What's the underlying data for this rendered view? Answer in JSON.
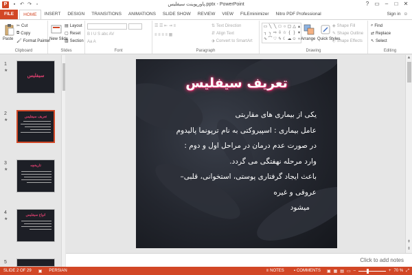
{
  "window": {
    "title": "پاورپوینت سیفلیس.pptx - PowerPoint",
    "controls": [
      "?",
      "▭",
      "–",
      "□",
      "✕"
    ]
  },
  "tabs": [
    {
      "label": "FILE"
    },
    {
      "label": "HOME"
    },
    {
      "label": "INSERT"
    },
    {
      "label": "DESIGN"
    },
    {
      "label": "TRANSITIONS"
    },
    {
      "label": "ANIMATIONS"
    },
    {
      "label": "SLIDE SHOW"
    },
    {
      "label": "REVIEW"
    },
    {
      "label": "VIEW"
    },
    {
      "label": "FILEminimizer"
    },
    {
      "label": "Nitro PDF Professional"
    }
  ],
  "active_tab": "HOME",
  "signin": "Sign in",
  "ribbon": {
    "clipboard": {
      "label": "Clipboard",
      "paste": "Paste",
      "cut": "Cut",
      "copy": "Copy",
      "format_painter": "Format Painter"
    },
    "slides": {
      "label": "Slides",
      "new_slide": "New Slide",
      "layout": "Layout",
      "reset": "Reset",
      "section": "Section"
    },
    "font": {
      "label": "Font"
    },
    "paragraph": {
      "label": "Paragraph",
      "text_direction": "Text Direction",
      "align_text": "Align Text",
      "convert_smartart": "Convert to SmartArt"
    },
    "drawing": {
      "label": "Drawing",
      "arrange": "Arrange",
      "quick_styles": "Quick Styles",
      "shape_fill": "Shape Fill",
      "shape_outline": "Shape Outline",
      "shape_effects": "Shape Effects"
    },
    "editing": {
      "label": "Editing",
      "find": "Find",
      "replace": "Replace",
      "select": "Select"
    }
  },
  "thumbnails": [
    {
      "num": "1",
      "title": "سیفلیس"
    },
    {
      "num": "2",
      "title": "تعریف سیفلیس"
    },
    {
      "num": "3",
      "title": "تاریخچه"
    },
    {
      "num": "4",
      "title": "انواع سیفلیس"
    },
    {
      "num": "5",
      "title": ""
    }
  ],
  "slide": {
    "title": "تعریف سیفلیس",
    "lines": [
      "یکی از بیماری های مقاربتی",
      "عامل بیماری : اسپیروکتی به نام ترپونما پالیدوم",
      "در صورت عدم درمان در مراحل اول و دوم :",
      "وارد مرحله نهفتگی می گردد.",
      "باعث ایجاد گرفتاری پوستی، استخوانی، قلبی– عروقی و غیره",
      "میشود"
    ]
  },
  "notes_placeholder": "Click to add notes",
  "status": {
    "slide_info": "SLIDE 2 OF 29",
    "language": "PERSIAN",
    "notes": "NOTES",
    "comments": "COMMENTS",
    "zoom": "70 %",
    "zoom_level": 0.7
  },
  "colors": {
    "accent": "#d24726",
    "title_glow": "#e0306a"
  }
}
